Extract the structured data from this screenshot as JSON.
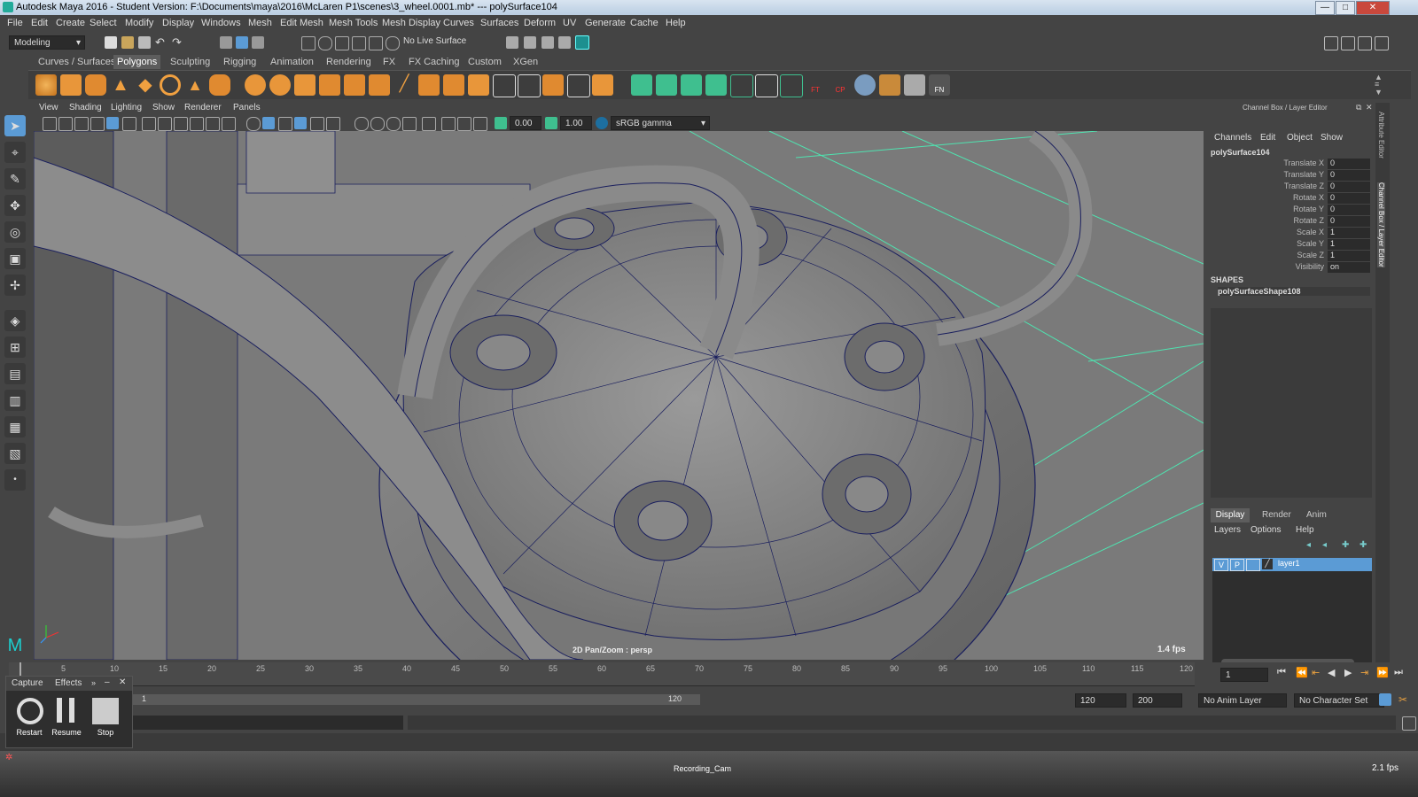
{
  "window": {
    "title": "Autodesk Maya 2016 - Student Version: F:\\Documents\\maya\\2016\\McLaren P1\\scenes\\3_wheel.0001.mb*  ---  polySurface104",
    "minimize": "—",
    "maximize": "□",
    "close": "✕"
  },
  "menu": [
    "File",
    "Edit",
    "Create",
    "Select",
    "Modify",
    "Display",
    "Windows",
    "Mesh",
    "Edit Mesh",
    "Mesh Tools",
    "Mesh Display",
    "Curves",
    "Surfaces",
    "Deform",
    "UV",
    "Generate",
    "Cache",
    "Help"
  ],
  "status_line": {
    "mode": "Modeling",
    "live_surface": "No Live Surface"
  },
  "shelf_tabs": [
    "Curves / Surfaces",
    "Polygons",
    "Sculpting",
    "Rigging",
    "Animation",
    "Rendering",
    "FX",
    "FX Caching",
    "Custom",
    "XGen"
  ],
  "shelf_active_tab": "Polygons",
  "shelf_labels": {
    "ft": "FT",
    "cp": "CP",
    "fn": "FN"
  },
  "panel_menu": [
    "View",
    "Shading",
    "Lighting",
    "Show",
    "Renderer",
    "Panels"
  ],
  "panel_toolbar": {
    "exposure": "0.00",
    "gamma": "1.00",
    "color_space": "sRGB gamma"
  },
  "viewport": {
    "camera_label": "2D Pan/Zoom : persp",
    "fps": "1.4 fps"
  },
  "channel_box": {
    "title": "Channel Box / Layer Editor",
    "menus": [
      "Channels",
      "Edit",
      "Object",
      "Show"
    ],
    "object": "polySurface104",
    "attributes": [
      {
        "label": "Translate X",
        "value": "0"
      },
      {
        "label": "Translate Y",
        "value": "0"
      },
      {
        "label": "Translate Z",
        "value": "0"
      },
      {
        "label": "Rotate X",
        "value": "0"
      },
      {
        "label": "Rotate Y",
        "value": "0"
      },
      {
        "label": "Rotate Z",
        "value": "0"
      },
      {
        "label": "Scale X",
        "value": "1"
      },
      {
        "label": "Scale Y",
        "value": "1"
      },
      {
        "label": "Scale Z",
        "value": "1"
      },
      {
        "label": "Visibility",
        "value": "on"
      }
    ],
    "shapes_header": "SHAPES",
    "shape": "polySurfaceShape108"
  },
  "layer_editor": {
    "tabs": [
      "Display",
      "Render",
      "Anim"
    ],
    "active_tab": "Display",
    "menus": [
      "Layers",
      "Options",
      "Help"
    ],
    "layer": {
      "v": "V",
      "p": "P",
      "name": "layer1"
    }
  },
  "side_tabs": [
    "Attribute Editor",
    "Channel Box / Layer Editor"
  ],
  "time_slider": {
    "ticks": [
      "5",
      "10",
      "15",
      "20",
      "25",
      "30",
      "35",
      "40",
      "45",
      "50",
      "55",
      "60",
      "65",
      "70",
      "75",
      "80",
      "85",
      "90",
      "95",
      "100",
      "105",
      "110",
      "115",
      "120"
    ],
    "current_frame": "1"
  },
  "range_slider": {
    "start": "1",
    "range_end": "120",
    "anim_end": "120",
    "max_end": "200",
    "anim_layer": "No Anim Layer",
    "char_set": "No Character Set"
  },
  "capture": {
    "tabs": [
      "Capture",
      "Effects"
    ],
    "restart": "Restart",
    "resume": "Resume",
    "stop": "Stop"
  },
  "bottom_bar": {
    "label": "Recording_Cam",
    "fps": "2.1 fps"
  },
  "colors": {
    "accent": "#5b9bd5",
    "selected_tab": "#5d5d5d",
    "wire": "#1a1f5e",
    "grid": "#4fe3b0"
  }
}
